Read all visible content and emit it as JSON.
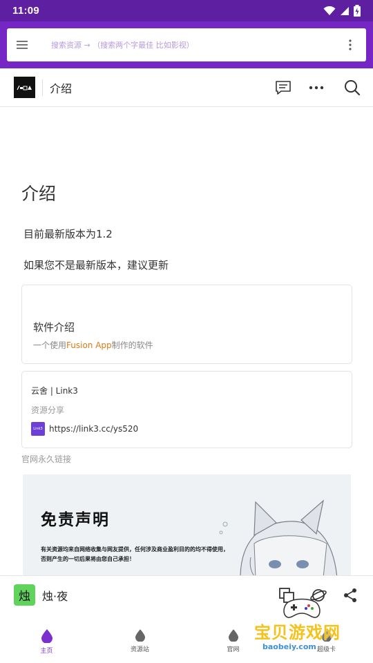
{
  "status_bar": {
    "time": "11:09"
  },
  "search": {
    "placeholder": "搜索资源 → （搜索两个字最佳 比如影视）"
  },
  "header": {
    "title": "介绍"
  },
  "content": {
    "page_title": "介绍",
    "version_text": "目前最新版本为1.2",
    "update_text": "如果您不是最新版本，建议更新",
    "card_intro": {
      "heading": "软件介绍",
      "sub_prefix": "一个使用",
      "sub_highlight": "Fusion App",
      "sub_suffix": "制作的软件"
    },
    "card_link": {
      "title": "云舍 | Link3",
      "desc": "资源分享",
      "favicon_text": "Link3",
      "url": "https://link3.cc/ys520"
    },
    "permalink_note": "官网永久链接",
    "banner": {
      "title": "免责声明",
      "line1": "有关资源均来自网络收集与网友提供，任何涉及商业盈利目的的均不得使用，",
      "line2": "否则产生的一切后果将由您自己承担！"
    }
  },
  "bottom_bar": {
    "app_icon_char": "烛",
    "app_name": "烛·夜"
  },
  "tabs": [
    {
      "label": "主页",
      "active": true
    },
    {
      "label": "资源站",
      "active": false
    },
    {
      "label": "官网",
      "active": false
    },
    {
      "label": "超级卡",
      "active": false
    }
  ],
  "watermark": {
    "text": "宝贝游戏网",
    "url": "baobeiy.com"
  },
  "colors": {
    "primary": "#7526c4",
    "status_bar": "#5e1fa0",
    "highlight": "#e07a14",
    "app_icon_bg": "#5fd35c"
  }
}
